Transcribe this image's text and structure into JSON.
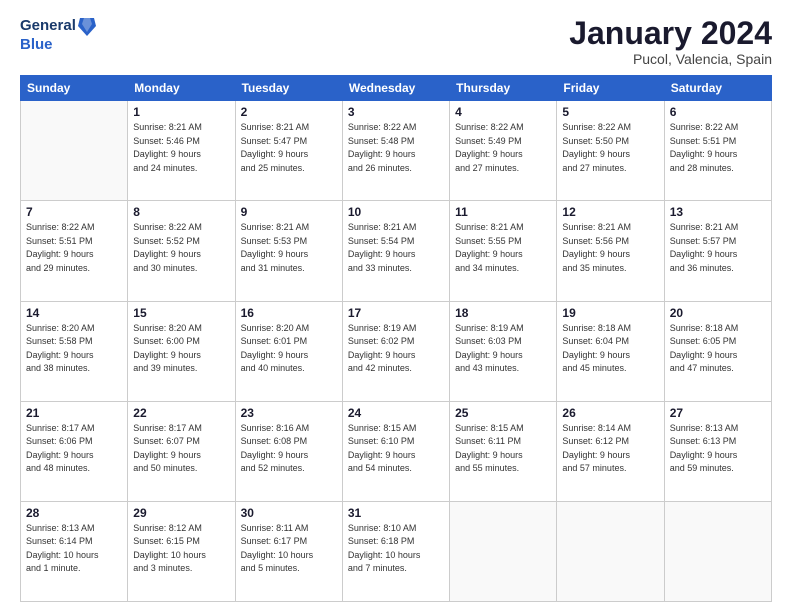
{
  "header": {
    "logo_line1": "General",
    "logo_line2": "Blue",
    "month": "January 2024",
    "location": "Pucol, Valencia, Spain"
  },
  "weekdays": [
    "Sunday",
    "Monday",
    "Tuesday",
    "Wednesday",
    "Thursday",
    "Friday",
    "Saturday"
  ],
  "weeks": [
    [
      {
        "day": "",
        "info": ""
      },
      {
        "day": "1",
        "info": "Sunrise: 8:21 AM\nSunset: 5:46 PM\nDaylight: 9 hours\nand 24 minutes."
      },
      {
        "day": "2",
        "info": "Sunrise: 8:21 AM\nSunset: 5:47 PM\nDaylight: 9 hours\nand 25 minutes."
      },
      {
        "day": "3",
        "info": "Sunrise: 8:22 AM\nSunset: 5:48 PM\nDaylight: 9 hours\nand 26 minutes."
      },
      {
        "day": "4",
        "info": "Sunrise: 8:22 AM\nSunset: 5:49 PM\nDaylight: 9 hours\nand 27 minutes."
      },
      {
        "day": "5",
        "info": "Sunrise: 8:22 AM\nSunset: 5:50 PM\nDaylight: 9 hours\nand 27 minutes."
      },
      {
        "day": "6",
        "info": "Sunrise: 8:22 AM\nSunset: 5:51 PM\nDaylight: 9 hours\nand 28 minutes."
      }
    ],
    [
      {
        "day": "7",
        "info": "Sunrise: 8:22 AM\nSunset: 5:51 PM\nDaylight: 9 hours\nand 29 minutes."
      },
      {
        "day": "8",
        "info": "Sunrise: 8:22 AM\nSunset: 5:52 PM\nDaylight: 9 hours\nand 30 minutes."
      },
      {
        "day": "9",
        "info": "Sunrise: 8:21 AM\nSunset: 5:53 PM\nDaylight: 9 hours\nand 31 minutes."
      },
      {
        "day": "10",
        "info": "Sunrise: 8:21 AM\nSunset: 5:54 PM\nDaylight: 9 hours\nand 33 minutes."
      },
      {
        "day": "11",
        "info": "Sunrise: 8:21 AM\nSunset: 5:55 PM\nDaylight: 9 hours\nand 34 minutes."
      },
      {
        "day": "12",
        "info": "Sunrise: 8:21 AM\nSunset: 5:56 PM\nDaylight: 9 hours\nand 35 minutes."
      },
      {
        "day": "13",
        "info": "Sunrise: 8:21 AM\nSunset: 5:57 PM\nDaylight: 9 hours\nand 36 minutes."
      }
    ],
    [
      {
        "day": "14",
        "info": "Sunrise: 8:20 AM\nSunset: 5:58 PM\nDaylight: 9 hours\nand 38 minutes."
      },
      {
        "day": "15",
        "info": "Sunrise: 8:20 AM\nSunset: 6:00 PM\nDaylight: 9 hours\nand 39 minutes."
      },
      {
        "day": "16",
        "info": "Sunrise: 8:20 AM\nSunset: 6:01 PM\nDaylight: 9 hours\nand 40 minutes."
      },
      {
        "day": "17",
        "info": "Sunrise: 8:19 AM\nSunset: 6:02 PM\nDaylight: 9 hours\nand 42 minutes."
      },
      {
        "day": "18",
        "info": "Sunrise: 8:19 AM\nSunset: 6:03 PM\nDaylight: 9 hours\nand 43 minutes."
      },
      {
        "day": "19",
        "info": "Sunrise: 8:18 AM\nSunset: 6:04 PM\nDaylight: 9 hours\nand 45 minutes."
      },
      {
        "day": "20",
        "info": "Sunrise: 8:18 AM\nSunset: 6:05 PM\nDaylight: 9 hours\nand 47 minutes."
      }
    ],
    [
      {
        "day": "21",
        "info": "Sunrise: 8:17 AM\nSunset: 6:06 PM\nDaylight: 9 hours\nand 48 minutes."
      },
      {
        "day": "22",
        "info": "Sunrise: 8:17 AM\nSunset: 6:07 PM\nDaylight: 9 hours\nand 50 minutes."
      },
      {
        "day": "23",
        "info": "Sunrise: 8:16 AM\nSunset: 6:08 PM\nDaylight: 9 hours\nand 52 minutes."
      },
      {
        "day": "24",
        "info": "Sunrise: 8:15 AM\nSunset: 6:10 PM\nDaylight: 9 hours\nand 54 minutes."
      },
      {
        "day": "25",
        "info": "Sunrise: 8:15 AM\nSunset: 6:11 PM\nDaylight: 9 hours\nand 55 minutes."
      },
      {
        "day": "26",
        "info": "Sunrise: 8:14 AM\nSunset: 6:12 PM\nDaylight: 9 hours\nand 57 minutes."
      },
      {
        "day": "27",
        "info": "Sunrise: 8:13 AM\nSunset: 6:13 PM\nDaylight: 9 hours\nand 59 minutes."
      }
    ],
    [
      {
        "day": "28",
        "info": "Sunrise: 8:13 AM\nSunset: 6:14 PM\nDaylight: 10 hours\nand 1 minute."
      },
      {
        "day": "29",
        "info": "Sunrise: 8:12 AM\nSunset: 6:15 PM\nDaylight: 10 hours\nand 3 minutes."
      },
      {
        "day": "30",
        "info": "Sunrise: 8:11 AM\nSunset: 6:17 PM\nDaylight: 10 hours\nand 5 minutes."
      },
      {
        "day": "31",
        "info": "Sunrise: 8:10 AM\nSunset: 6:18 PM\nDaylight: 10 hours\nand 7 minutes."
      },
      {
        "day": "",
        "info": ""
      },
      {
        "day": "",
        "info": ""
      },
      {
        "day": "",
        "info": ""
      }
    ]
  ]
}
